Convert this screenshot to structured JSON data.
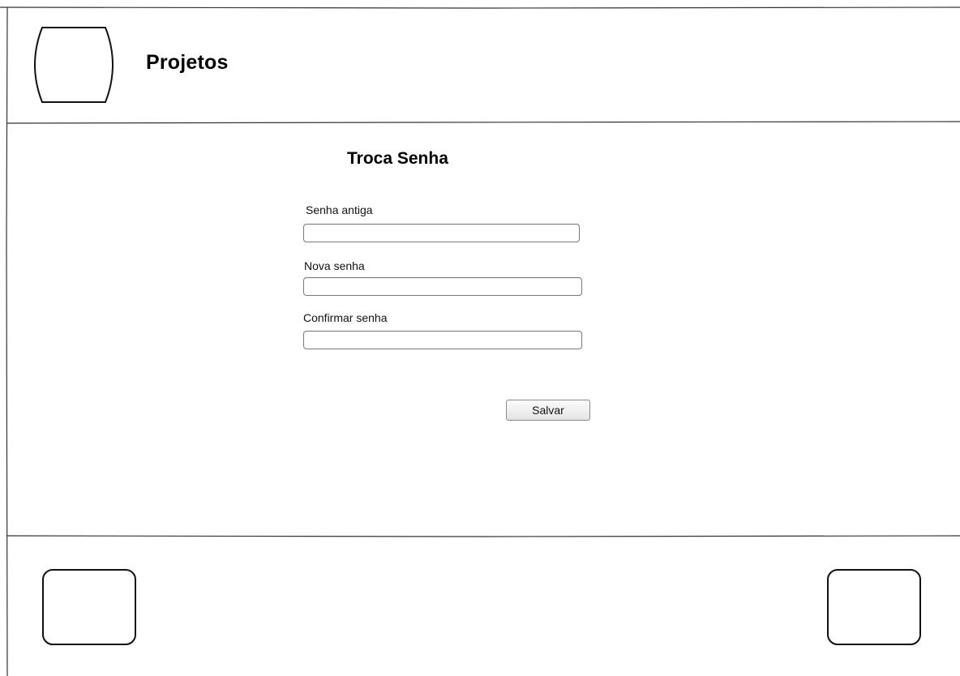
{
  "header": {
    "title": "Projetos"
  },
  "form": {
    "title": "Troca Senha",
    "fields": [
      {
        "label": "Senha antiga",
        "value": "",
        "placeholder": ""
      },
      {
        "label": "Nova senha",
        "value": "",
        "placeholder": ""
      },
      {
        "label": "Confirmar senha",
        "value": "",
        "placeholder": ""
      }
    ],
    "save_label": "Salvar"
  }
}
